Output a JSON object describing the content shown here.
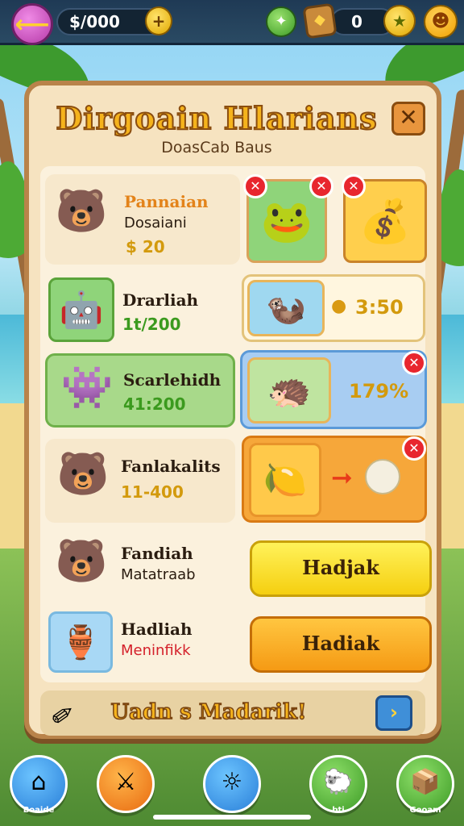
{
  "topbar": {
    "back_icon": "back-arrow-icon",
    "coins": "$/000",
    "coin_plus": "+",
    "count": "0"
  },
  "panel": {
    "title": "Dirgoain Hlarians",
    "subtitle": "DoasCab Baus",
    "close": "✕"
  },
  "rows": [
    {
      "name": "Pannaian",
      "sub": "Dosaiani",
      "value": "$ 20",
      "avatar": "bear-icon"
    },
    {
      "name": "Drarliah",
      "value": "1t/200",
      "avatar": "robot-toy-icon",
      "reward": "3:50"
    },
    {
      "name": "Scarlehidh",
      "value": "41:200",
      "avatar": "pink-creature-icon",
      "reward": "179%"
    },
    {
      "name": "Fanlakalits",
      "value": "11-400",
      "avatar": "bear-icon"
    },
    {
      "name": "Fandiah",
      "sub": "Matatraab",
      "avatar": "bear-icon",
      "button": "Hadjak"
    },
    {
      "name": "Hadliah",
      "sub": "Meninfikk",
      "avatar": "golden-item-icon",
      "button": "Hadiak"
    }
  ],
  "footer": {
    "text": "Uadn   s Madarik!",
    "next": "›"
  },
  "nav": [
    {
      "label": "Boaide",
      "icon": "home-icon"
    },
    {
      "label": "",
      "icon": "sword-icon"
    },
    {
      "label": "",
      "icon": "globe-icon"
    },
    {
      "label": "bti",
      "icon": "animal-icon"
    },
    {
      "label": "Geoam",
      "icon": "box-icon"
    }
  ],
  "colors": {
    "panel_border": "#b9834a",
    "title_fill": "#f5b31c",
    "value_green": "#3b9a1e",
    "badge_red": "#e8262e"
  }
}
